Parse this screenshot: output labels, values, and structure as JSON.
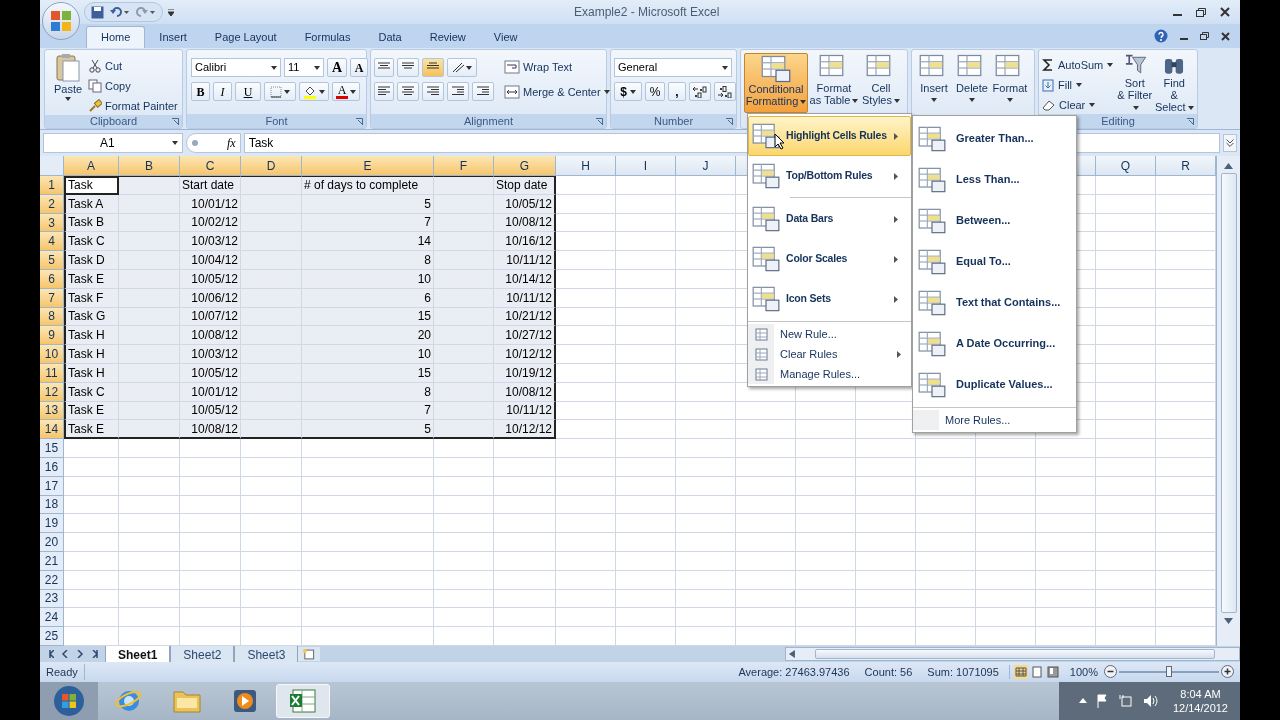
{
  "window": {
    "title": "Example2 - Microsoft Excel"
  },
  "tabs": [
    {
      "label": "Home",
      "selected": true
    },
    {
      "label": "Insert",
      "selected": false
    },
    {
      "label": "Page Layout",
      "selected": false
    },
    {
      "label": "Formulas",
      "selected": false
    },
    {
      "label": "Data",
      "selected": false
    },
    {
      "label": "Review",
      "selected": false
    },
    {
      "label": "View",
      "selected": false
    }
  ],
  "clipboard": {
    "label": "Clipboard",
    "paste": "Paste",
    "cut": "Cut",
    "copy": "Copy",
    "format_painter": "Format Painter"
  },
  "font": {
    "label": "Font",
    "name": "Calibri",
    "size": "11",
    "grow": "A",
    "shrink": "A",
    "bold": "B",
    "italic": "I",
    "underline": "U",
    "font_color": "A"
  },
  "alignment": {
    "label": "Alignment",
    "wrap_text": "Wrap Text",
    "merge_center": "Merge & Center"
  },
  "number": {
    "label": "Number",
    "format": "General",
    "currency": "$",
    "percent": "%",
    "comma": ","
  },
  "styles": {
    "conditional_formatting": {
      "label": "Conditional Formatting",
      "open": true
    },
    "format_as_table": "Format as Table",
    "cell_styles": "Cell Styles"
  },
  "cells": {
    "insert": "Insert",
    "delete": "Delete",
    "format": "Format"
  },
  "editing": {
    "label": "Editing",
    "autosum": "AutoSum",
    "fill": "Fill",
    "clear": "Clear",
    "sort_filter": "Sort & Filter",
    "find_select": "Find & Select"
  },
  "formula_bar": {
    "name_box": "A1",
    "function_label": "fx",
    "value": "Task"
  },
  "sheet": {
    "columns": [
      {
        "label": "A",
        "selected": true
      },
      {
        "label": "B",
        "selected": true
      },
      {
        "label": "C",
        "selected": true
      },
      {
        "label": "D",
        "selected": true
      },
      {
        "label": "E",
        "selected": true
      },
      {
        "label": "F",
        "selected": true
      },
      {
        "label": "G",
        "selected": true
      },
      {
        "label": "H",
        "selected": false
      },
      {
        "label": "I",
        "selected": false
      },
      {
        "label": "J",
        "selected": false
      },
      {
        "label": "Q",
        "selected": false
      },
      {
        "label": "R",
        "selected": false
      }
    ],
    "rows": [
      {
        "row": "1",
        "selected": true,
        "a": "Task",
        "c": "Start date",
        "e": "# of days to complete",
        "g": "Stop date"
      },
      {
        "row": "2",
        "selected": true,
        "a": "Task A",
        "c": "10/01/12",
        "e": "5",
        "g": "10/05/12"
      },
      {
        "row": "3",
        "selected": true,
        "a": "Task B",
        "c": "10/02/12",
        "e": "7",
        "g": "10/08/12"
      },
      {
        "row": "4",
        "selected": true,
        "a": "Task C",
        "c": "10/03/12",
        "e": "14",
        "g": "10/16/12"
      },
      {
        "row": "5",
        "selected": true,
        "a": "Task D",
        "c": "10/04/12",
        "e": "8",
        "g": "10/11/12"
      },
      {
        "row": "6",
        "selected": true,
        "a": "Task E",
        "c": "10/05/12",
        "e": "10",
        "g": "10/14/12"
      },
      {
        "row": "7",
        "selected": true,
        "a": "Task F",
        "c": "10/06/12",
        "e": "6",
        "g": "10/11/12"
      },
      {
        "row": "8",
        "selected": true,
        "a": "Task G",
        "c": "10/07/12",
        "e": "15",
        "g": "10/21/12"
      },
      {
        "row": "9",
        "selected": true,
        "a": "Task H",
        "c": "10/08/12",
        "e": "20",
        "g": "10/27/12"
      },
      {
        "row": "10",
        "selected": true,
        "a": "Task H",
        "c": "10/03/12",
        "e": "10",
        "g": "10/12/12"
      },
      {
        "row": "11",
        "selected": true,
        "a": "Task H",
        "c": "10/05/12",
        "e": "15",
        "g": "10/19/12"
      },
      {
        "row": "12",
        "selected": true,
        "a": "Task C",
        "c": "10/01/12",
        "e": "8",
        "g": "10/08/12"
      },
      {
        "row": "13",
        "selected": true,
        "a": "Task E",
        "c": "10/05/12",
        "e": "7",
        "g": "10/11/12"
      },
      {
        "row": "14",
        "selected": true,
        "a": "Task E",
        "c": "10/08/12",
        "e": "5",
        "g": "10/12/12"
      },
      {
        "row": "15",
        "selected": false
      },
      {
        "row": "16",
        "selected": false
      },
      {
        "row": "17",
        "selected": false
      },
      {
        "row": "18",
        "selected": false
      },
      {
        "row": "19",
        "selected": false
      },
      {
        "row": "20",
        "selected": false
      },
      {
        "row": "21",
        "selected": false
      },
      {
        "row": "22",
        "selected": false
      },
      {
        "row": "23",
        "selected": false
      },
      {
        "row": "24",
        "selected": false
      },
      {
        "row": "25",
        "selected": false
      }
    ]
  },
  "menu": {
    "items": [
      {
        "kind": "large",
        "label": "Highlight Cells Rules",
        "selected": true,
        "has_submenu": true
      },
      {
        "kind": "large",
        "label": "Top/Bottom Rules",
        "selected": false,
        "has_submenu": true
      },
      {
        "kind": "large",
        "label": "Data Bars",
        "selected": false,
        "has_submenu": true
      },
      {
        "kind": "large",
        "label": "Color Scales",
        "selected": false,
        "has_submenu": true
      },
      {
        "kind": "large",
        "label": "Icon Sets",
        "selected": false,
        "has_submenu": true
      },
      {
        "kind": "small",
        "label": "New Rule...",
        "selected": false,
        "has_submenu": false
      },
      {
        "kind": "small",
        "label": "Clear Rules",
        "selected": false,
        "has_submenu": true
      },
      {
        "kind": "small",
        "label": "Manage Rules...",
        "selected": false,
        "has_submenu": false
      }
    ]
  },
  "submenu": {
    "items": [
      {
        "kind": "large",
        "label": "Greater Than..."
      },
      {
        "kind": "large",
        "label": "Less Than..."
      },
      {
        "kind": "large",
        "label": "Between..."
      },
      {
        "kind": "large",
        "label": "Equal To..."
      },
      {
        "kind": "large",
        "label": "Text that Contains..."
      },
      {
        "kind": "large",
        "label": "A Date Occurring..."
      },
      {
        "kind": "large",
        "label": "Duplicate Values..."
      },
      {
        "kind": "small",
        "label": "More Rules..."
      }
    ]
  },
  "sheet_tabs": [
    {
      "label": "Sheet1",
      "selected": true
    },
    {
      "label": "Sheet2",
      "selected": false
    },
    {
      "label": "Sheet3",
      "selected": false
    }
  ],
  "status_bar": {
    "mode": "Ready",
    "average": "Average: 27463.97436",
    "count": "Count: 56",
    "sum": "Sum: 1071095",
    "zoom": "100%",
    "zoom_slider": {
      "level": 0.5
    }
  },
  "taskbar": {
    "apps": [
      {
        "kind": "browser",
        "selected": false
      },
      {
        "kind": "folder",
        "selected": false
      },
      {
        "kind": "media",
        "selected": false
      },
      {
        "kind": "spreadsheet",
        "selected": true
      }
    ],
    "time": "8:04 AM",
    "date": "12/14/2012"
  }
}
